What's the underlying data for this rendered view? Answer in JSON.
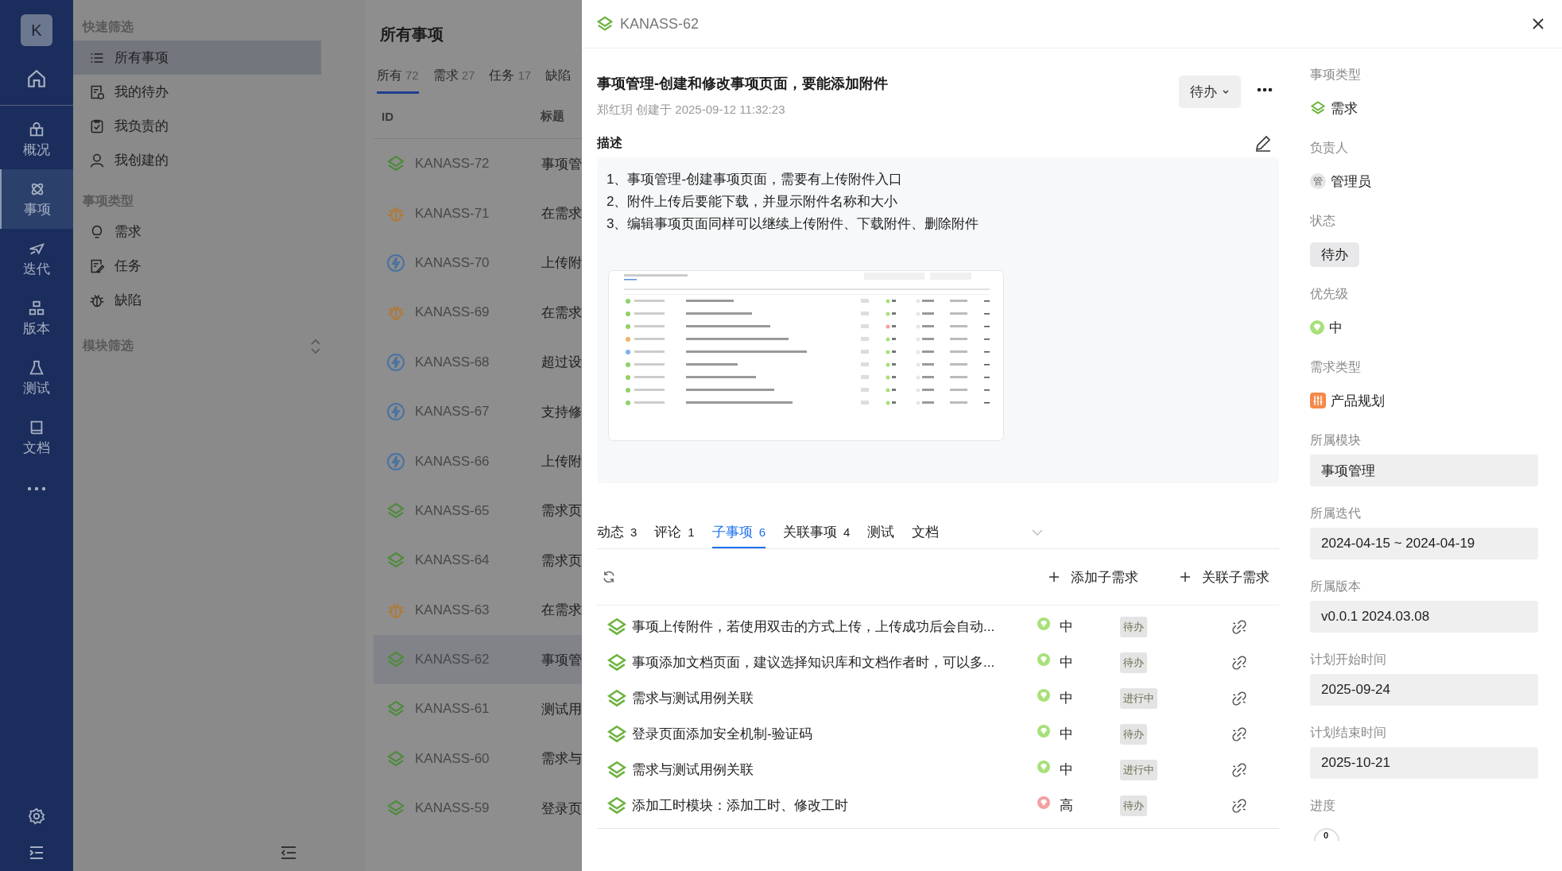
{
  "nav": {
    "avatar": "K",
    "items": [
      {
        "label": "概况",
        "selected": false
      },
      {
        "label": "事项",
        "selected": true
      },
      {
        "label": "迭代",
        "selected": false
      },
      {
        "label": "版本",
        "selected": false
      },
      {
        "label": "测试",
        "selected": false
      },
      {
        "label": "文档",
        "selected": false
      }
    ]
  },
  "filters": {
    "sections": [
      {
        "title": "快速筛选",
        "items": [
          {
            "label": "所有事项",
            "selected": true
          },
          {
            "label": "我的待办",
            "selected": false
          },
          {
            "label": "我负责的",
            "selected": false
          },
          {
            "label": "我创建的",
            "selected": false
          }
        ]
      },
      {
        "title": "事项类型",
        "items": [
          {
            "label": "需求",
            "selected": false
          },
          {
            "label": "任务",
            "selected": false
          },
          {
            "label": "缺陷",
            "selected": false
          }
        ]
      }
    ],
    "module_filter": "模块筛选"
  },
  "list": {
    "title": "所有事项",
    "tabs": [
      {
        "label": "所有",
        "count": "72",
        "selected": true
      },
      {
        "label": "需求",
        "count": "27",
        "selected": false
      },
      {
        "label": "任务",
        "count": "17",
        "selected": false
      },
      {
        "label": "缺陷",
        "selected": false
      }
    ],
    "columns": [
      "ID",
      "标题"
    ],
    "rows": [
      {
        "id": "KANASS-72",
        "title": "事项管",
        "kind": "story",
        "selected": false
      },
      {
        "id": "KANASS-71",
        "title": "在需求",
        "kind": "bug",
        "selected": false
      },
      {
        "id": "KANASS-70",
        "title": "上传附",
        "kind": "task",
        "selected": false
      },
      {
        "id": "KANASS-69",
        "title": "在需求",
        "kind": "bug",
        "selected": false
      },
      {
        "id": "KANASS-68",
        "title": "超过设",
        "kind": "task",
        "selected": false
      },
      {
        "id": "KANASS-67",
        "title": "支持修",
        "kind": "task",
        "selected": false
      },
      {
        "id": "KANASS-66",
        "title": "上传附",
        "kind": "task",
        "selected": false
      },
      {
        "id": "KANASS-65",
        "title": "需求页",
        "kind": "story",
        "selected": false
      },
      {
        "id": "KANASS-64",
        "title": "需求页",
        "kind": "story",
        "selected": false
      },
      {
        "id": "KANASS-63",
        "title": "在需求",
        "kind": "bug",
        "selected": false
      },
      {
        "id": "KANASS-62",
        "title": "事项管",
        "kind": "story",
        "selected": true
      },
      {
        "id": "KANASS-61",
        "title": "测试用",
        "kind": "story",
        "selected": false
      },
      {
        "id": "KANASS-60",
        "title": "需求与",
        "kind": "story",
        "selected": false
      },
      {
        "id": "KANASS-59",
        "title": "登录页",
        "kind": "story",
        "selected": false
      }
    ]
  },
  "drawer": {
    "id": "KANASS-62",
    "title": "事项管理-创建和修改事项页面，要能添加附件",
    "meta": "郑红玥 创建于 2025-09-12 11:32:23",
    "status": "待办",
    "description": {
      "label": "描述",
      "lines": [
        "1、事项管理-创建事项页面，需要有上传附件入口",
        "2、附件上传后要能下载，并显示附件名称和大小",
        "3、编辑事项页面同样可以继续上传附件、下载附件、删除附件"
      ],
      "image": {
        "kind": "screenshot"
      }
    },
    "tabs": [
      {
        "label": "动态",
        "count": "3",
        "selected": false
      },
      {
        "label": "评论",
        "count": "1",
        "selected": false
      },
      {
        "label": "子事项",
        "count": "6",
        "selected": true
      },
      {
        "label": "关联事项",
        "count": "4",
        "selected": false
      },
      {
        "label": "测试",
        "selected": false
      },
      {
        "label": "文档",
        "selected": false
      }
    ],
    "actions": [
      "添加子需求",
      "关联子需求"
    ],
    "sub_items": [
      {
        "title": "事项上传附件，若使用双击的方式上传，上传成功后会自动...",
        "priority": "中",
        "color": "#a8e07a",
        "status": "待办"
      },
      {
        "title": "事项添加文档页面，建议选择知识库和文档作者时，可以多...",
        "priority": "中",
        "color": "#a8e07a",
        "status": "待办"
      },
      {
        "title": "需求与测试用例关联",
        "priority": "中",
        "color": "#a8e07a",
        "status": "进行中"
      },
      {
        "title": "登录页面添加安全机制-验证码",
        "priority": "中",
        "color": "#a8e07a",
        "status": "待办"
      },
      {
        "title": "需求与测试用例关联",
        "priority": "中",
        "color": "#a8e07a",
        "status": "进行中"
      },
      {
        "title": "添加工时模块：添加工时、修改工时",
        "priority": "高",
        "color": "#f4a0a0",
        "status": "待办"
      }
    ],
    "fields": [
      {
        "label": "事项类型",
        "kind": "type",
        "value": "需求"
      },
      {
        "label": "负责人",
        "kind": "person",
        "avatar": "管",
        "value": "管理员"
      },
      {
        "label": "状态",
        "kind": "tag",
        "value": "待办"
      },
      {
        "label": "优先级",
        "kind": "priority",
        "color": "#a8e07a",
        "value": "中"
      },
      {
        "label": "需求类型",
        "kind": "category",
        "value": "产品规划"
      },
      {
        "label": "所属模块",
        "kind": "box",
        "value": "事项管理"
      },
      {
        "label": "所属迭代",
        "kind": "box",
        "value": "2024-04-15 ~ 2024-04-19"
      },
      {
        "label": "所属版本",
        "kind": "box",
        "value": "v0.0.1 2024.03.08"
      },
      {
        "label": "计划开始时间",
        "kind": "box",
        "value": "2025-09-24"
      },
      {
        "label": "计划结束时间",
        "kind": "box",
        "value": "2025-10-21"
      },
      {
        "label": "进度",
        "kind": "progress",
        "value": "0"
      }
    ]
  }
}
